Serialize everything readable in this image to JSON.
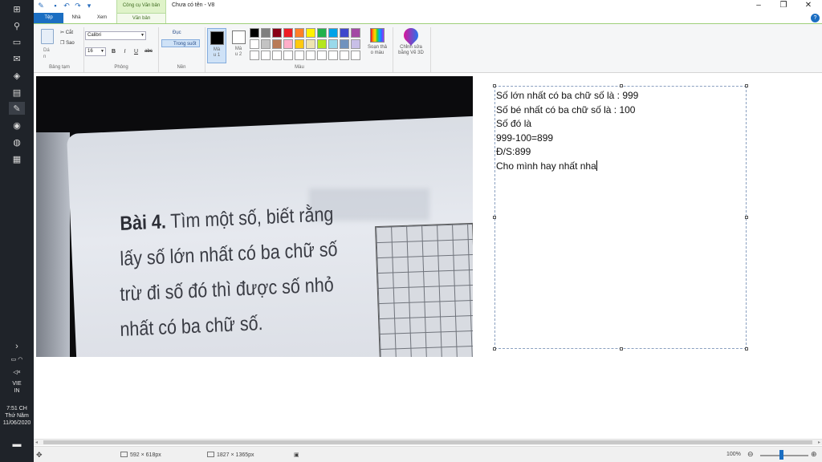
{
  "window": {
    "title": "Chưa có tên - V8",
    "contextual_tab": "Công cụ Văn bản"
  },
  "tabs": [
    "Tệp",
    "Nhà",
    "Xem",
    "Văn bản"
  ],
  "ribbon": {
    "clipboard": {
      "paste": "Dá\nn",
      "cut": "Cắt",
      "copy": "Sao",
      "label": "Bảng tạm"
    },
    "font": {
      "name": "Calibri",
      "size": "16",
      "bold": "B",
      "italic": "I",
      "underline": "U",
      "strike": "abc",
      "label": "Phông"
    },
    "background": {
      "opaque": "Đục",
      "transparent": "Trong suốt",
      "label": "Nền"
    },
    "colors": {
      "color1": "Mà\nu 1",
      "color2": "Mà\nu 2",
      "label": "Màu",
      "edit_colors": "Soạn thả\no màu",
      "paint3d": "Chỉnh sửa\nbằng Vẽ 3D",
      "palette": [
        "#000000",
        "#7f7f7f",
        "#880015",
        "#ed1c24",
        "#ff7f27",
        "#fff200",
        "#22b14c",
        "#00a2e8",
        "#3f48cc",
        "#a349a4",
        "#ffffff",
        "#c3c3c3",
        "#b97a57",
        "#ffaec9",
        "#ffc90e",
        "#efe4b0",
        "#b5e61d",
        "#99d9ea",
        "#7092be",
        "#c8bfe7",
        "#ffffff",
        "#ffffff",
        "#ffffff",
        "#ffffff",
        "#ffffff",
        "#ffffff",
        "#ffffff",
        "#ffffff",
        "#ffffff",
        "#ffffff"
      ]
    }
  },
  "photo": {
    "lines": [
      {
        "bold": "Bài 4.",
        "rest": " Tìm một số, biết rằng"
      },
      {
        "bold": "",
        "rest": "lấy số lớn nhất có ba chữ số"
      },
      {
        "bold": "",
        "rest": "trừ đi số đó thì được số nhỏ"
      },
      {
        "bold": "",
        "rest": "nhất có ba chữ số."
      }
    ]
  },
  "textbox": {
    "lines": [
      "Số lớn nhất có ba chữ số là : 999",
      "Số bé nhất có ba chữ số là : 100",
      "Số đó là",
      "999-100=899",
      "Đ/S:899",
      "Cho mình hay nhất nha"
    ]
  },
  "status": {
    "selection_size": "592 × 618px",
    "image_size": "1827 × 1365px",
    "zoom": "100%"
  },
  "taskbar": {
    "language": [
      "VIE",
      "IN"
    ],
    "time": "7:51 CH",
    "day": "Thứ Năm",
    "date": "11/06/2020"
  }
}
